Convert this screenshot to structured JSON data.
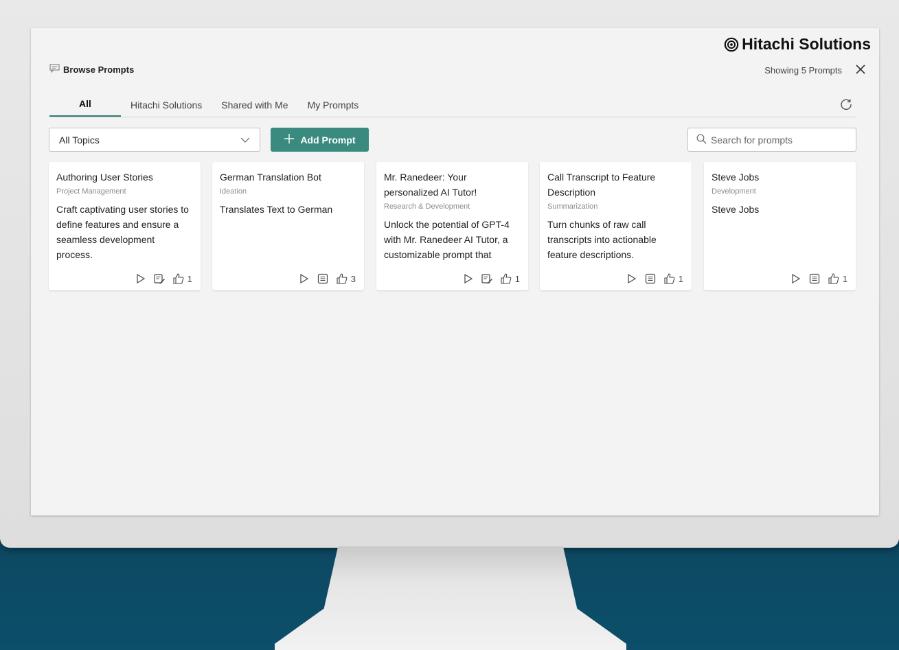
{
  "brand": {
    "name": "Hitachi Solutions"
  },
  "panel": {
    "title": "Browse Prompts",
    "showing": "Showing 5 Prompts"
  },
  "tabs": [
    {
      "label": "All",
      "active": true
    },
    {
      "label": "Hitachi Solutions",
      "active": false
    },
    {
      "label": "Shared with Me",
      "active": false
    },
    {
      "label": "My Prompts",
      "active": false
    }
  ],
  "filters": {
    "topic_selected": "All Topics",
    "add_label": "Add Prompt",
    "search_placeholder": "Search for prompts"
  },
  "cards": [
    {
      "title": "Authoring User Stories",
      "topic": "Project Management",
      "description": "Craft captivating user stories to define features and ensure a seamless development process.",
      "likes": "1",
      "detail_icon": "edit-note-icon"
    },
    {
      "title": "German Translation Bot",
      "topic": "Ideation",
      "description": "Translates Text to German",
      "likes": "3",
      "detail_icon": "list-icon"
    },
    {
      "title": "Mr. Ranedeer: Your personalized AI Tutor!",
      "topic": "Research & Development",
      "description": "Unlock the potential of GPT-4 with Mr. Ranedeer AI Tutor, a customizable prompt that",
      "likes": "1",
      "detail_icon": "edit-note-icon"
    },
    {
      "title": "Call Transcript to Feature Description",
      "topic": "Summarization",
      "description": "Turn chunks of raw call transcripts into actionable feature descriptions.",
      "likes": "1",
      "detail_icon": "list-icon"
    },
    {
      "title": "Steve Jobs",
      "topic": "Development",
      "description": "Steve Jobs",
      "likes": "1",
      "detail_icon": "list-icon"
    }
  ],
  "colors": {
    "accent": "#3a8a80",
    "screen_bg": "#f3f3f3",
    "backdrop": "#0f3d55"
  }
}
